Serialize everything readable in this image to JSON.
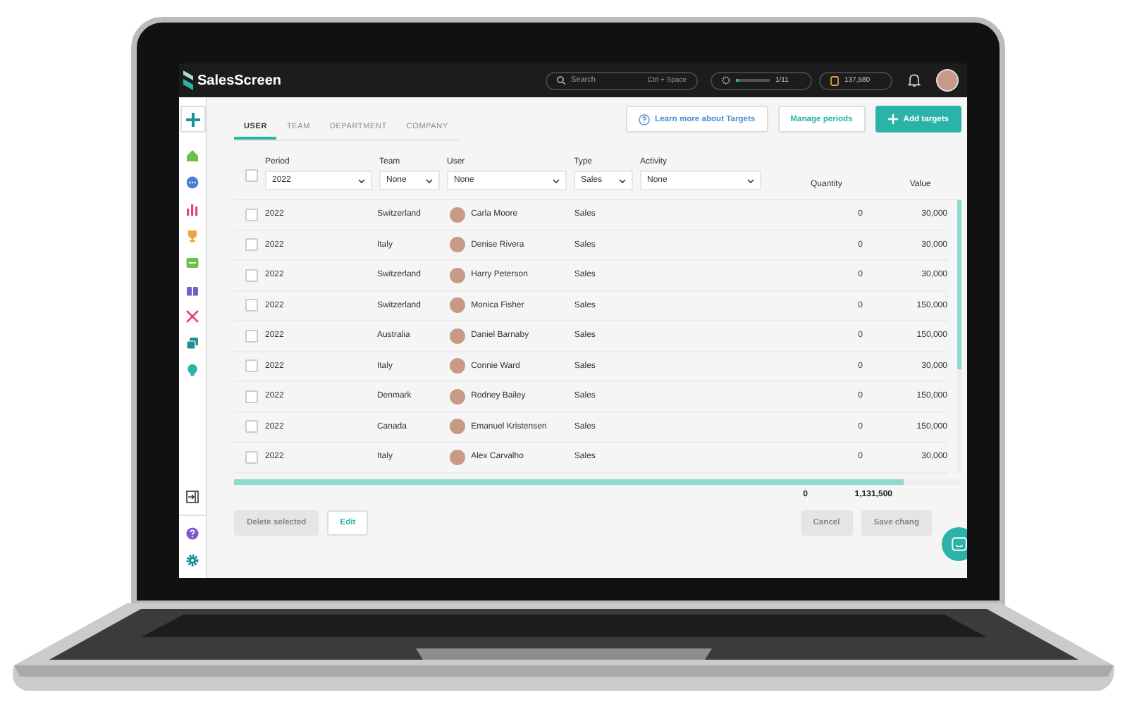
{
  "top_bar": {
    "logo": "SalesScreen",
    "search": {
      "placeholder": "Search",
      "shortcut": "Ctrl + Space"
    },
    "progress": {
      "level": 0.09,
      "reading": "1/11"
    },
    "coins": "137,580"
  },
  "tabs": [
    {
      "label": "USER",
      "selected": true
    },
    {
      "label": "TEAM",
      "selected": false
    },
    {
      "label": "DEPARTMENT",
      "selected": false
    },
    {
      "label": "COMPANY",
      "selected": false
    }
  ],
  "header_buttons": [
    {
      "label": "Learn more about Targets",
      "kind": "info"
    },
    {
      "label": "Manage periods",
      "kind": "outline"
    },
    {
      "label": "Add targets",
      "kind": "primary"
    }
  ],
  "select_all": {
    "checked": false
  },
  "filters": [
    {
      "label": "Period",
      "value": "2022"
    },
    {
      "label": "Team",
      "value": "None"
    },
    {
      "label": "User",
      "value": "None"
    },
    {
      "label": "Type",
      "value": "Sales"
    },
    {
      "label": "Activity",
      "value": "None"
    }
  ],
  "columns": [
    "Quantity",
    "Value"
  ],
  "rows": [
    {
      "checked": false,
      "period": "2022",
      "team": "Switzerland",
      "user": "Carla Moore",
      "type": "Sales",
      "quantity": "0",
      "value": "30,000"
    },
    {
      "checked": false,
      "period": "2022",
      "team": "Italy",
      "user": "Denise Rivera",
      "type": "Sales",
      "quantity": "0",
      "value": "30,000"
    },
    {
      "checked": false,
      "period": "2022",
      "team": "Switzerland",
      "user": "Harry Peterson",
      "type": "Sales",
      "quantity": "0",
      "value": "30,000"
    },
    {
      "checked": false,
      "period": "2022",
      "team": "Switzerland",
      "user": "Monica Fisher",
      "type": "Sales",
      "quantity": "0",
      "value": "150,000"
    },
    {
      "checked": false,
      "period": "2022",
      "team": "Australia",
      "user": "Daniel Barnaby",
      "type": "Sales",
      "quantity": "0",
      "value": "150,000"
    },
    {
      "checked": false,
      "period": "2022",
      "team": "Italy",
      "user": "Connie Ward",
      "type": "Sales",
      "quantity": "0",
      "value": "30,000"
    },
    {
      "checked": false,
      "period": "2022",
      "team": "Denmark",
      "user": "Rodney Bailey",
      "type": "Sales",
      "quantity": "0",
      "value": "150,000"
    },
    {
      "checked": false,
      "period": "2022",
      "team": "Canada",
      "user": "Emanuel Kristensen",
      "type": "Sales",
      "quantity": "0",
      "value": "150,000"
    },
    {
      "checked": false,
      "period": "2022",
      "team": "Italy",
      "user": "Alex Carvalho",
      "type": "Sales",
      "quantity": "0",
      "value": "30,000"
    }
  ],
  "totals": {
    "quantity": "0",
    "value": "1,131,500"
  },
  "footer_left": [
    {
      "label": "Delete selected",
      "kind": "grey"
    },
    {
      "label": "Edit",
      "kind": "outline"
    }
  ],
  "footer_right": [
    {
      "label": "Cancel",
      "kind": "grey"
    },
    {
      "label": "Save chang",
      "kind": "grey"
    }
  ]
}
